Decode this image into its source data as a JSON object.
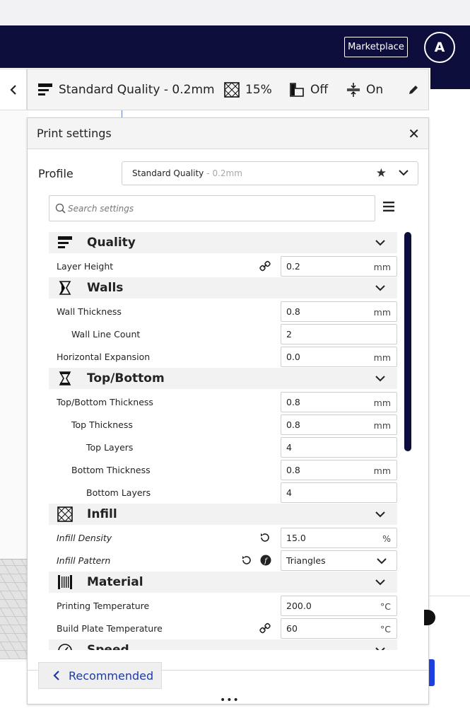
{
  "topbar": {
    "marketplace_label": "Marketplace",
    "avatar_initial": "A"
  },
  "header_bar": {
    "profile": "Standard Quality - 0.2mm",
    "infill": "15%",
    "support": "Off",
    "adhesion": "On"
  },
  "panel": {
    "title": "Print settings",
    "profile_label": "Profile",
    "profile_name": "Standard Quality",
    "profile_sub": " - 0.2mm",
    "search_placeholder": "Search settings",
    "footer_button": "Recommended"
  },
  "categories": {
    "quality": "Quality",
    "walls": "Walls",
    "topbottom": "Top/Bottom",
    "infill": "Infill",
    "material": "Material",
    "speed": "Speed"
  },
  "settings": {
    "layer_height": {
      "label": "Layer Height",
      "value": "0.2",
      "unit": "mm"
    },
    "wall_thickness": {
      "label": "Wall Thickness",
      "value": "0.8",
      "unit": "mm"
    },
    "wall_line_count": {
      "label": "Wall Line Count",
      "value": "2"
    },
    "horizontal_expansion": {
      "label": "Horizontal Expansion",
      "value": "0.0",
      "unit": "mm"
    },
    "topbottom_thickness": {
      "label": "Top/Bottom Thickness",
      "value": "0.8",
      "unit": "mm"
    },
    "top_thickness": {
      "label": "Top Thickness",
      "value": "0.8",
      "unit": "mm"
    },
    "top_layers": {
      "label": "Top Layers",
      "value": "4"
    },
    "bottom_thickness": {
      "label": "Bottom Thickness",
      "value": "0.8",
      "unit": "mm"
    },
    "bottom_layers": {
      "label": "Bottom Layers",
      "value": "4"
    },
    "infill_density": {
      "label": "Infill Density",
      "value": "15.0",
      "unit": "%"
    },
    "infill_pattern": {
      "label": "Infill Pattern",
      "value": "Triangles"
    },
    "printing_temperature": {
      "label": "Printing Temperature",
      "value": "200.0",
      "unit": "°C"
    },
    "build_plate_temperature": {
      "label": "Build Plate Temperature",
      "value": "60",
      "unit": "°C"
    }
  },
  "colors": {
    "navbar": "#0e0e3c",
    "accent": "#1e3aa8",
    "scrollbar": "#0e0e3c"
  }
}
